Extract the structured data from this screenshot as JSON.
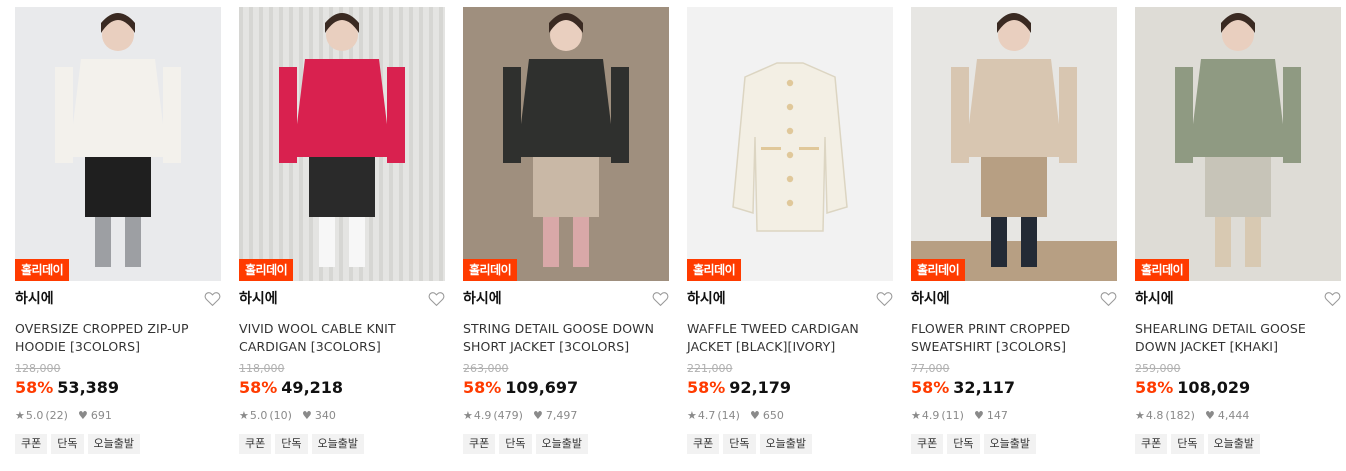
{
  "products": [
    {
      "badge": "홀리데이",
      "brand": "하시에",
      "name_line1": "OVERSIZE CROPPED ZIP-UP",
      "name_line2": "HOODIE [3COLORS]",
      "original_price": "128,000",
      "discount": "58%",
      "price": "53,389",
      "rating": "5.0",
      "reviews": "(22)",
      "likes": "691",
      "tags": [
        "쿠폰",
        "단독",
        "오늘출발"
      ],
      "image_desc_colors": [
        "#e9eaec",
        "#f3f1ec",
        "#9d9fa3",
        "#1f1f1f"
      ]
    },
    {
      "badge": "홀리데이",
      "brand": "하시에",
      "name_line1": "VIVID WOOL CABLE KNIT",
      "name_line2": "CARDIGAN [3COLORS]",
      "original_price": "118,000",
      "discount": "58%",
      "price": "49,218",
      "rating": "5.0",
      "reviews": "(10)",
      "likes": "340",
      "tags": [
        "쿠폰",
        "단독",
        "오늘출발"
      ],
      "image_desc_colors": [
        "#e4e4e2",
        "#d9214f",
        "#f7f7f7",
        "#2a2a2a"
      ]
    },
    {
      "badge": "홀리데이",
      "brand": "하시에",
      "name_line1": "STRING DETAIL GOOSE DOWN",
      "name_line2": "SHORT JACKET [3COLORS]",
      "original_price": "263,000",
      "discount": "58%",
      "price": "109,697",
      "rating": "4.9",
      "reviews": "(479)",
      "likes": "7,497",
      "tags": [
        "쿠폰",
        "단독",
        "오늘출발"
      ],
      "image_desc_colors": [
        "#9f8f7e",
        "#2f302e",
        "#d9a8a8",
        "#c9b8a6"
      ]
    },
    {
      "badge": "홀리데이",
      "brand": "하시에",
      "name_line1": "WAFFLE TWEED CARDIGAN",
      "name_line2": "JACKET [BLACK][IVORY]",
      "original_price": "221,000",
      "discount": "58%",
      "price": "92,179",
      "rating": "4.7",
      "reviews": "(14)",
      "likes": "650",
      "tags": [
        "쿠폰",
        "단독",
        "오늘출발"
      ],
      "image_desc_colors": [
        "#f2f2f2",
        "#f3efe4",
        "#dcd5c2",
        "#e6d3a8"
      ]
    },
    {
      "badge": "홀리데이",
      "brand": "하시에",
      "name_line1": "FLOWER PRINT CROPPED",
      "name_line2": "SWEATSHIRT [3COLORS]",
      "original_price": "77,000",
      "discount": "58%",
      "price": "32,117",
      "rating": "4.9",
      "reviews": "(11)",
      "likes": "147",
      "tags": [
        "쿠폰",
        "단독",
        "오늘출발"
      ],
      "image_desc_colors": [
        "#e7e6e3",
        "#d8c6b1",
        "#232a35",
        "#b79f83"
      ]
    },
    {
      "badge": "홀리데이",
      "brand": "하시에",
      "name_line1": "SHEARLING DETAIL GOOSE",
      "name_line2": "DOWN JACKET [KHAKI]",
      "original_price": "259,000",
      "discount": "58%",
      "price": "108,029",
      "rating": "4.8",
      "reviews": "(182)",
      "likes": "4,444",
      "tags": [
        "쿠폰",
        "단독",
        "오늘출발"
      ],
      "image_desc_colors": [
        "#dedcd6",
        "#8f9a82",
        "#d8c9b2",
        "#c7c4b8"
      ]
    }
  ],
  "icons": {
    "heart": "heart-outline-icon",
    "star": "star-icon",
    "like": "heart-filled-icon"
  },
  "colors": {
    "badge": "#ff3b00",
    "discount": "#ff3b00",
    "tag_bg": "#f2f2f2"
  }
}
